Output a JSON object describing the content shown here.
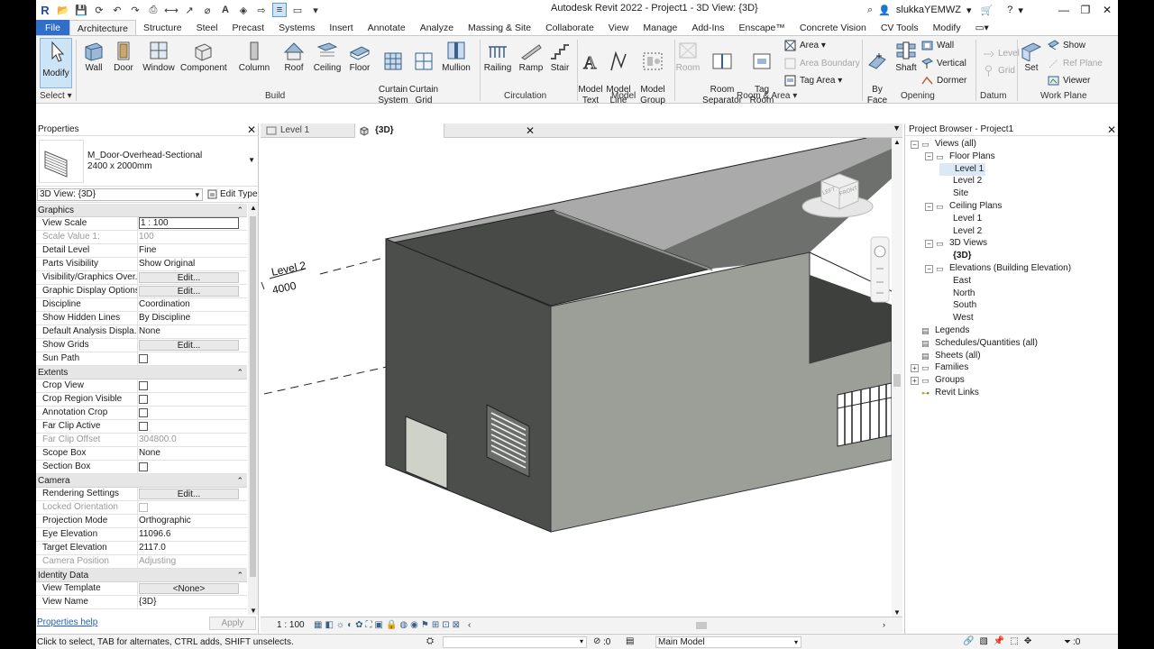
{
  "app": {
    "title": "Autodesk Revit 2022 - Project1 - 3D View: {3D}",
    "brand": "R"
  },
  "user": {
    "name": "slukkaYEMWZ"
  },
  "tabs": [
    "File",
    "Architecture",
    "Structure",
    "Steel",
    "Precast",
    "Systems",
    "Insert",
    "Annotate",
    "Analyze",
    "Massing & Site",
    "Collaborate",
    "View",
    "Manage",
    "Add-Ins",
    "Enscape™",
    "Concrete Vision",
    "CV Tools",
    "Modify"
  ],
  "active_tab": "Architecture",
  "ribbon": {
    "select": {
      "modify": "Modify",
      "label": "Select ▾"
    },
    "build": {
      "label": "Build",
      "wall": "Wall",
      "door": "Door",
      "window": "Window",
      "component": "Component",
      "column": "Column",
      "roof": "Roof",
      "ceiling": "Ceiling",
      "floor": "Floor",
      "curtain_system": "Curtain\nSystem",
      "curtain_grid": "Curtain\nGrid",
      "mullion": "Mullion"
    },
    "circulation": {
      "label": "Circulation",
      "railing": "Railing",
      "ramp": "Ramp",
      "stair": "Stair"
    },
    "model": {
      "label": "Model",
      "model_text": "Model\nText",
      "model_line": "Model\nLine",
      "model_group": "Model\nGroup"
    },
    "room_area": {
      "label": "Room & Area ▾",
      "room": "Room",
      "room_separator": "Room\nSeparator",
      "tag_room": "Tag\nRoom",
      "area": "Area ▾",
      "area_boundary": "Area  Boundary",
      "tag_area": "Tag  Area ▾"
    },
    "opening": {
      "label": "Opening",
      "by_face": "By\nFace",
      "shaft": "Shaft",
      "wall": "Wall",
      "vertical": "Vertical",
      "dormer": "Dormer"
    },
    "datum": {
      "label": "Datum",
      "level": "Level",
      "grid": "Grid"
    },
    "work_plane": {
      "label": "Work Plane",
      "set": "Set",
      "show": "Show",
      "ref_plane": "Ref  Plane",
      "viewer": "Viewer"
    }
  },
  "properties": {
    "title": "Properties",
    "type_name": "M_Door-Overhead-Sectional",
    "type_size": "2400 x 2000mm",
    "instance": "3D View: {3D}",
    "edit_type": "Edit Type",
    "groups": [
      {
        "name": "Graphics",
        "rows": [
          {
            "n": "View Scale",
            "v": "1 : 100",
            "kind": "box"
          },
          {
            "n": "Scale Value    1:",
            "v": "100",
            "dim": true
          },
          {
            "n": "Detail Level",
            "v": "Fine"
          },
          {
            "n": "Parts Visibility",
            "v": "Show Original"
          },
          {
            "n": "Visibility/Graphics Over...",
            "v": "Edit...",
            "kind": "btn"
          },
          {
            "n": "Graphic Display Options",
            "v": "Edit...",
            "kind": "btn"
          },
          {
            "n": "Discipline",
            "v": "Coordination"
          },
          {
            "n": "Show Hidden Lines",
            "v": "By Discipline"
          },
          {
            "n": "Default Analysis Displa...",
            "v": "None"
          },
          {
            "n": "Show Grids",
            "v": "Edit...",
            "kind": "btn"
          },
          {
            "n": "Sun Path",
            "v": "",
            "kind": "cb"
          }
        ]
      },
      {
        "name": "Extents",
        "rows": [
          {
            "n": "Crop View",
            "v": "",
            "kind": "cb"
          },
          {
            "n": "Crop Region Visible",
            "v": "",
            "kind": "cb"
          },
          {
            "n": "Annotation Crop",
            "v": "",
            "kind": "cb"
          },
          {
            "n": "Far Clip Active",
            "v": "",
            "kind": "cb"
          },
          {
            "n": "Far Clip Offset",
            "v": "304800.0",
            "dim": true
          },
          {
            "n": "Scope Box",
            "v": "None"
          },
          {
            "n": "Section Box",
            "v": "",
            "kind": "cb"
          }
        ]
      },
      {
        "name": "Camera",
        "rows": [
          {
            "n": "Rendering Settings",
            "v": "Edit...",
            "kind": "btn"
          },
          {
            "n": "Locked Orientation",
            "v": "",
            "kind": "cb",
            "dim": true
          },
          {
            "n": "Projection Mode",
            "v": "Orthographic"
          },
          {
            "n": "Eye Elevation",
            "v": "11096.6"
          },
          {
            "n": "Target Elevation",
            "v": "2117.0"
          },
          {
            "n": "Camera Position",
            "v": "Adjusting",
            "dim": true
          }
        ]
      },
      {
        "name": "Identity Data",
        "rows": [
          {
            "n": "View Template",
            "v": "<None>",
            "kind": "btn"
          },
          {
            "n": "View Name",
            "v": "{3D}"
          }
        ]
      }
    ],
    "help": "Properties help",
    "apply": "Apply"
  },
  "view_tabs": {
    "level1": "Level 1",
    "active": "{3D}"
  },
  "viewport": {
    "level_name": "Level 2",
    "level_elev": "4000",
    "cube_left": "LEFT",
    "cube_front": "FRONT"
  },
  "view_control": {
    "scale": "1 : 100"
  },
  "browser": {
    "title": "Project Browser - Project1",
    "nodes": [
      {
        "t": "Views (all)",
        "lvl": 0,
        "exp": "−"
      },
      {
        "t": "Floor Plans",
        "lvl": 1,
        "exp": "−"
      },
      {
        "t": "Level 1",
        "lvl": 2,
        "sel": true
      },
      {
        "t": "Level 2",
        "lvl": 2
      },
      {
        "t": "Site",
        "lvl": 2
      },
      {
        "t": "Ceiling Plans",
        "lvl": 1,
        "exp": "−"
      },
      {
        "t": "Level 1",
        "lvl": 2
      },
      {
        "t": "Level 2",
        "lvl": 2
      },
      {
        "t": "3D Views",
        "lvl": 1,
        "exp": "−"
      },
      {
        "t": "{3D}",
        "lvl": 2,
        "bold": true
      },
      {
        "t": "Elevations (Building Elevation)",
        "lvl": 1,
        "exp": "−"
      },
      {
        "t": "East",
        "lvl": 2
      },
      {
        "t": "North",
        "lvl": 2
      },
      {
        "t": "South",
        "lvl": 2
      },
      {
        "t": "West",
        "lvl": 2
      },
      {
        "t": "Legends",
        "lvl": 0,
        "icon": true
      },
      {
        "t": "Schedules/Quantities (all)",
        "lvl": 0,
        "icon": true
      },
      {
        "t": "Sheets (all)",
        "lvl": 0,
        "icon": true
      },
      {
        "t": "Families",
        "lvl": 0,
        "exp": "+"
      },
      {
        "t": "Groups",
        "lvl": 0,
        "exp": "+"
      },
      {
        "t": "Revit Links",
        "lvl": 0,
        "link": true
      }
    ]
  },
  "status": {
    "message": "Click to select, TAB for alternates, CTRL adds, SHIFT unselects.",
    "zero1": ":0",
    "model": "Main Model",
    "filter": ":0"
  }
}
